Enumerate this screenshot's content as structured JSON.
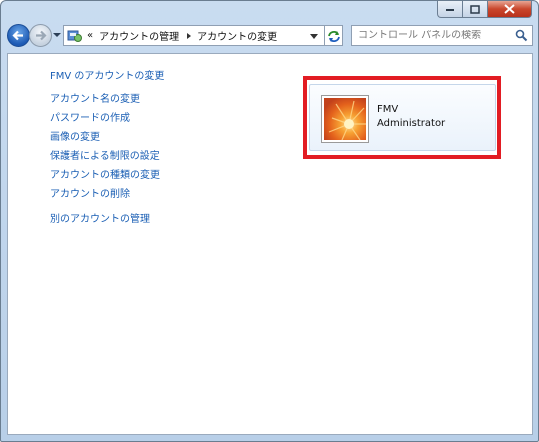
{
  "breadcrumb": {
    "chevron": "«",
    "items": [
      "アカウントの管理",
      "アカウントの変更"
    ]
  },
  "search": {
    "placeholder": "コントロール パネルの検索"
  },
  "links": {
    "header": "FMV のアカウントの変更",
    "group": [
      "アカウント名の変更",
      "パスワードの作成",
      "画像の変更",
      "保護者による制限の設定",
      "アカウントの種類の変更",
      "アカウントの削除"
    ],
    "other": "別のアカウントの管理"
  },
  "account": {
    "name": "FMV",
    "type": "Administrator"
  },
  "colors": {
    "link": "#1b5fb4",
    "highlight": "#e21c23"
  },
  "icons": [
    "back-arrow-icon",
    "forward-arrow-icon",
    "control-panel-icon",
    "refresh-icon",
    "search-icon"
  ]
}
